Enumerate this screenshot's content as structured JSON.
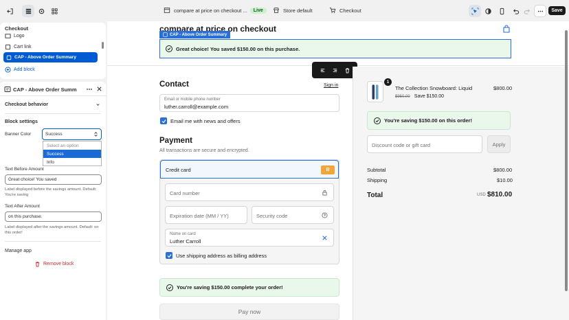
{
  "topbar": {
    "page_name": "compare at price on checkout ...",
    "live_badge": "Live",
    "store_label": "Store default",
    "checkout_label": "Checkout",
    "save_label": "Save"
  },
  "sidebar": {
    "section_title": "Checkout",
    "items": [
      {
        "label": "Logo"
      },
      {
        "label": "Cart link"
      },
      {
        "label": "CAP - Above Order Summary"
      }
    ],
    "add_block": "Add block"
  },
  "block_panel": {
    "title": "CAP - Above Order Summ",
    "checkout_behavior": "Checkout behavior",
    "block_settings": "Block settings",
    "banner_color_label": "Banner Color",
    "banner_color_value": "Success",
    "dropdown_options": [
      "Select an option",
      "Success",
      "Info"
    ],
    "text_before_label": "Text Before Amount",
    "text_before_value": "Great choice! You saved",
    "text_before_hint": "Label displayed before the savings amount. Default: You're saving",
    "text_after_label": "Text After Amount",
    "text_after_value": "on this purchase.",
    "text_after_hint": "Label displayed after the savings amount. Default: on this order!",
    "manage_app": "Manage app",
    "remove_block": "Remove block"
  },
  "preview": {
    "title": "compare at price on checkout",
    "cap_tag": "CAP - Above Order Summary",
    "cap_banner": "Great choice! You saved $150.00 on this purchase.",
    "contact_heading": "Contact",
    "sign_in": "Sign in",
    "email_label": "Email or mobile phone number",
    "email_value": "luther.carroll@example.com",
    "email_news": "Email me with news and offers",
    "payment_heading": "Payment",
    "payment_sub": "All transactions are secure and encrypted.",
    "credit_card": "Credit card",
    "card_badge": "B",
    "card_number_ph": "Card number",
    "expiration_ph": "Expiration date (MM / YY)",
    "security_ph": "Security code",
    "name_label": "Name on card",
    "name_value": "Luther Carroll",
    "use_shipping": "Use shipping address as billing address",
    "bottom_banner": "You're saving $150.00 complete your order!",
    "pay_now": "Pay now"
  },
  "summary": {
    "quantity": "1",
    "product_name": "The Collection Snowboard: Liquid",
    "product_price": "$800.00",
    "compare_price": "$950.00",
    "save_text": "Save $150.00",
    "saving_banner": "You're saving $150.00 on this order!",
    "discount_ph": "Discount code or gift card",
    "apply": "Apply",
    "subtotal_label": "Subtotal",
    "subtotal_value": "$800.00",
    "shipping_label": "Shipping",
    "shipping_value": "$10.00",
    "total_label": "Total",
    "currency": "USD",
    "total_value": "$810.00"
  }
}
